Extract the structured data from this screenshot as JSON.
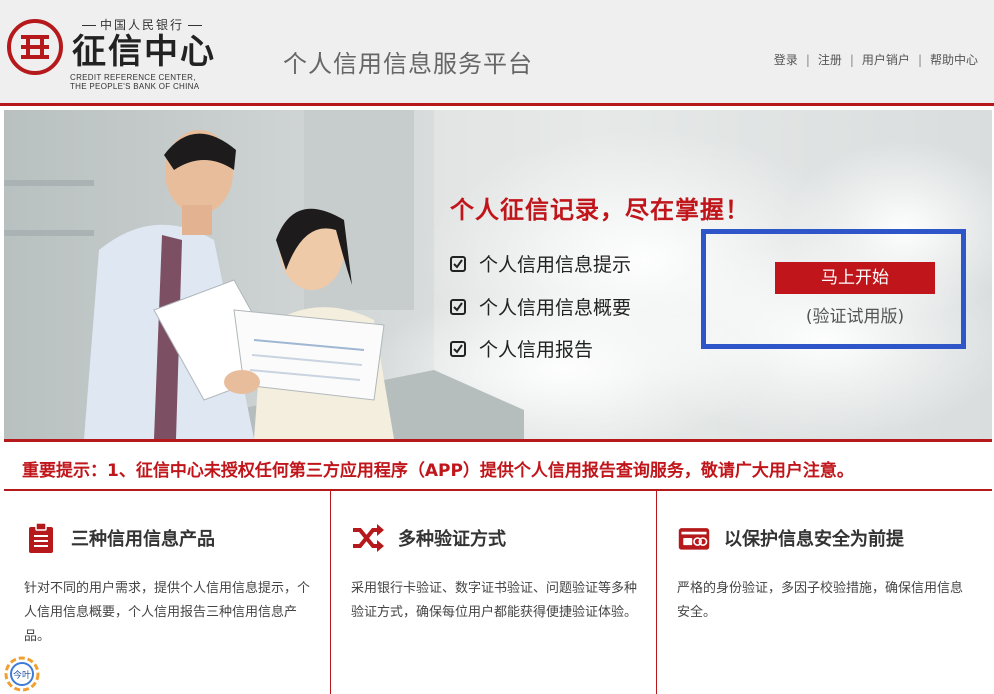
{
  "header": {
    "logo_top": "中国人民银行",
    "logo_main": "征信中心",
    "logo_en_line1": "CREDIT REFERENCE CENTER,",
    "logo_en_line2": "THE PEOPLE'S BANK OF CHINA",
    "platform_title": "个人信用信息服务平台",
    "nav": [
      "登录",
      "注册",
      "用户销户",
      "帮助中心"
    ]
  },
  "banner": {
    "slogan": "个人征信记录，尽在掌握！",
    "features": [
      "个人信用信息提示",
      "个人信用信息概要",
      "个人信用报告"
    ],
    "start_button": "马上开始",
    "start_sub": "(验证试用版)"
  },
  "notice": "重要提示：1、征信中心未授权任何第三方应用程序（APP）提供个人信用报告查询服务，敬请广大用户注意。",
  "columns": [
    {
      "icon": "clipboard-icon",
      "title": "三种信用信息产品",
      "text": "针对不同的用户需求，提供个人信用信息提示，个人信用信息概要，个人信用报告三种信用信息产品。"
    },
    {
      "icon": "shuffle-icon",
      "title": "多种验证方式",
      "text": "采用银行卡验证、数字证书验证、问题验证等多种验证方式，确保每位用户都能获得便捷验证体验。"
    },
    {
      "icon": "id-card-icon",
      "title": "以保护信息安全为前提",
      "text": "严格的身份验证，多因子校验措施，确保信用信息安全。"
    }
  ],
  "colors": {
    "brand_red": "#c0161b",
    "highlight_blue": "#2e56c8"
  },
  "badge_label": "今叶"
}
